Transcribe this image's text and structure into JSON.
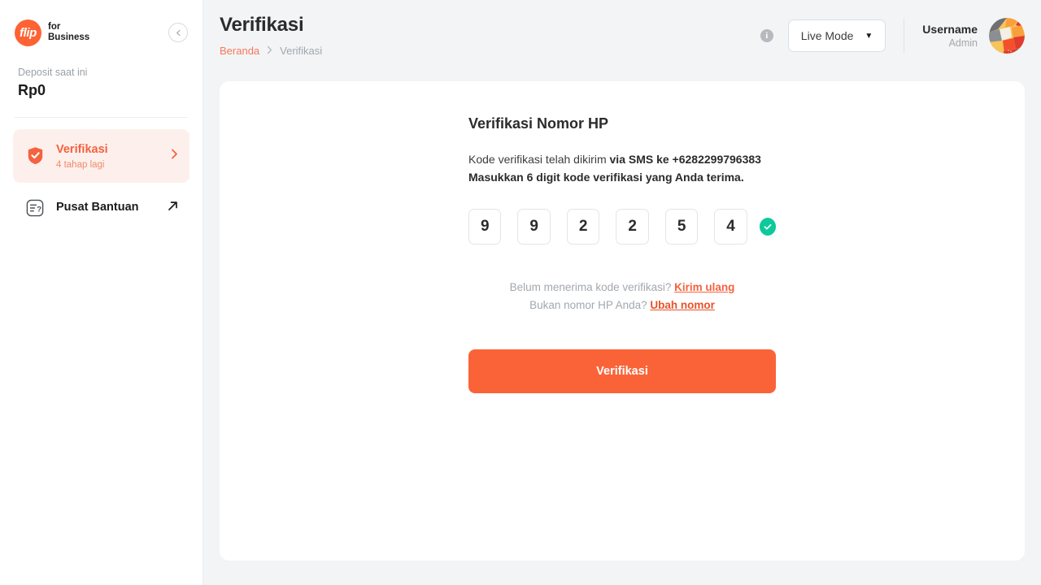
{
  "sidebar": {
    "logo": {
      "mark_text": "flip",
      "line1": "for",
      "line2": "Business"
    },
    "collapse_icon": "chevron-left-icon",
    "deposit": {
      "label": "Deposit saat ini",
      "value": "Rp0"
    },
    "items": [
      {
        "id": "verifikasi",
        "label": "Verifikasi",
        "sublabel": "4 tahap lagi",
        "icon": "shield-check-icon",
        "trailing_icon": "chevron-right-icon",
        "active": true
      },
      {
        "id": "pusat-bantuan",
        "label": "Pusat Bantuan",
        "sublabel": "",
        "icon": "help-document-icon",
        "trailing_icon": "external-link-arrow-icon",
        "active": false
      }
    ]
  },
  "header": {
    "title": "Verifikasi",
    "breadcrumb": {
      "home": "Beranda",
      "separator": "›",
      "current": "Verifikasi"
    },
    "info_icon": "info-icon",
    "mode": {
      "label": "Live Mode",
      "caret": "▼"
    },
    "user": {
      "name": "Username",
      "role": "Admin",
      "avatar": "user-avatar"
    }
  },
  "main": {
    "title": "Verifikasi Nomor HP",
    "desc_part1": "Kode verifikasi telah dikirim ",
    "desc_bold1": "via SMS ke +6282299796383",
    "desc_bold2": "Masukkan 6 digit kode verifikasi yang Anda terima.",
    "otp": {
      "digits": [
        "9",
        "9",
        "2",
        "2",
        "5",
        "4"
      ],
      "valid": true,
      "check_icon": "check-circle-icon"
    },
    "resend": {
      "line1_text": "Belum menerima kode verifikasi? ",
      "line1_link": "Kirim ulang",
      "line2_text": "Bukan nomor HP Anda? ",
      "line2_link": "Ubah nomor"
    },
    "submit_label": "Verifikasi"
  },
  "colors": {
    "brand_orange": "#fa6338",
    "brand_orange_light": "#fdf0ec",
    "link_orange": "#f4623f",
    "success_green": "#0ec99a",
    "page_bg": "#f2f4f6"
  }
}
